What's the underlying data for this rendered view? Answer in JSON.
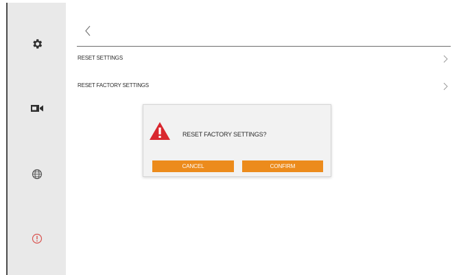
{
  "sidebar": {
    "items": [
      {
        "icon": "gear-icon"
      },
      {
        "icon": "video-camera-icon"
      },
      {
        "icon": "globe-icon"
      },
      {
        "icon": "info-icon",
        "color": "#d9534f"
      }
    ]
  },
  "header": {
    "back_icon": "chevron-left-icon"
  },
  "menu": {
    "items": [
      {
        "label": "RESET SETTINGS"
      },
      {
        "label": "RESET FACTORY SETTINGS"
      }
    ]
  },
  "dialog": {
    "icon": "warning-icon",
    "message": "RESET FACTORY SETTINGS?",
    "cancel_label": "CANCEL",
    "confirm_label": "CONFIRM"
  },
  "colors": {
    "accent": "#ec8b1c",
    "warning": "#d9272e",
    "sidebar_bg": "#e9e9e9"
  }
}
